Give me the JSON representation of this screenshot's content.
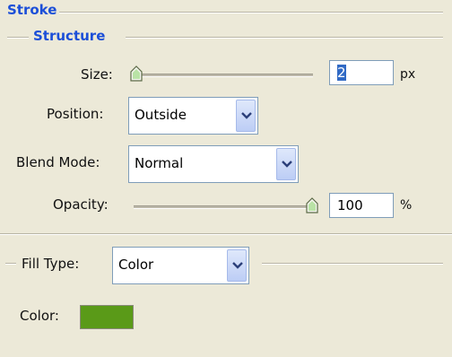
{
  "stroke": {
    "title": "Stroke"
  },
  "structure": {
    "title": "Structure",
    "size": {
      "label": "Size:",
      "value": "2",
      "unit": "px"
    },
    "position": {
      "label": "Position:",
      "selected": "Outside"
    },
    "blend_mode": {
      "label": "Blend Mode:",
      "selected": "Normal"
    },
    "opacity": {
      "label": "Opacity:",
      "value": "100",
      "unit": "%"
    }
  },
  "fill": {
    "type_label": "Fill Type:",
    "type_selected": "Color",
    "color_label": "Color:",
    "color_value": "#5a9a18"
  },
  "icons": [
    "chevron-down-icon",
    "slider-thumb-icon"
  ],
  "colors": {
    "title_blue": "#1c4fd8",
    "background": "#ece9d8",
    "dropdown_button": "#bccdf5"
  }
}
